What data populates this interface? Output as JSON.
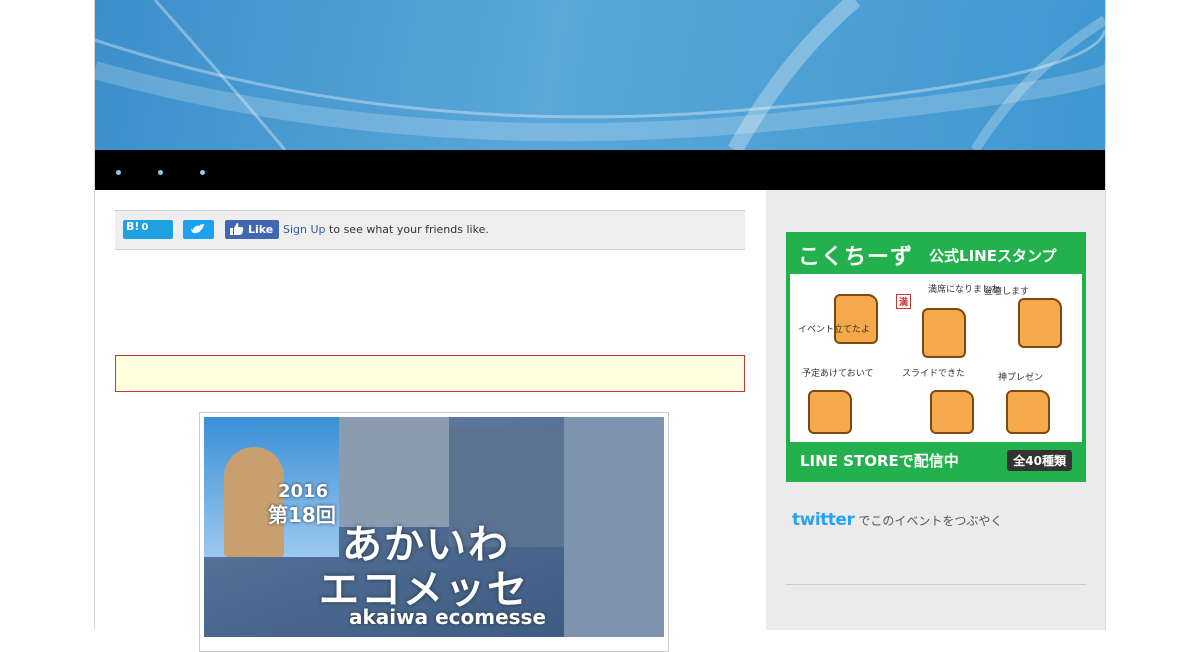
{
  "nav": {
    "items": [
      "",
      "",
      ""
    ]
  },
  "share": {
    "hatena_label": "B!",
    "hatena_count": "0",
    "fb_like_label": "Like",
    "fb_signup": "Sign Up",
    "fb_text": "to see what your friends like."
  },
  "poster": {
    "year": "2016",
    "edition": "第18回",
    "title_line1": "あかいわ",
    "title_line2": "エコメッセ",
    "title_romaji": "akaiwa ecomesse"
  },
  "sidebar": {
    "stamp": {
      "brand": "こくちーず",
      "title": "公式LINEスタンプ",
      "captions": [
        "イベント立てたよ",
        "満席になりました",
        "登壇します",
        "予定あけておいて",
        "スライドできた",
        "神プレゼン"
      ],
      "badge_char": "満",
      "store_text": "LINE STOREで配信中",
      "count_tag": "全40種類"
    },
    "twitter_logo": "twitter",
    "twitter_text": "でこのイベントをつぶやく"
  }
}
